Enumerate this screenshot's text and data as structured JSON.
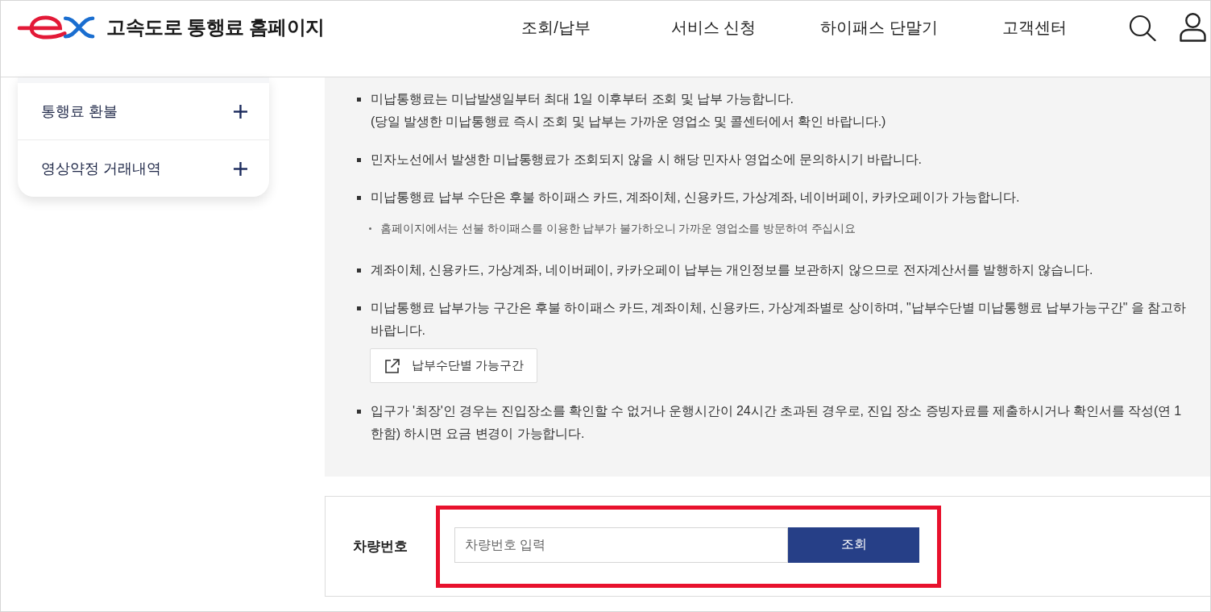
{
  "header": {
    "title": "고속도로 통행료 홈페이지",
    "nav": [
      {
        "label": "조회/납부"
      },
      {
        "label": "서비스 신청"
      },
      {
        "label": "하이패스 단말기"
      },
      {
        "label": "고객센터"
      }
    ]
  },
  "sidebar": {
    "items": [
      {
        "label": "통행료 환불",
        "expanded": false
      },
      {
        "label": "영상약정 거래내역",
        "expanded": false
      }
    ]
  },
  "notices": [
    {
      "lines": [
        "미납통행료는 미납발생일부터 최대 1일 이후부터 조회 및 납부 가능합니다.",
        "(당일 발생한 미납통행료 즉시 조회 및 납부는 가까운 영업소 및 콜센터에서 확인 바랍니다.)"
      ]
    },
    {
      "lines": [
        "민자노선에서 발생한 미납통행료가 조회되지 않을 시 해당 민자사 영업소에 문의하시기 바랍니다."
      ]
    },
    {
      "lines": [
        "미납통행료 납부 수단은 후불 하이패스 카드, 계좌이체, 신용카드, 가상계좌, 네이버페이, 카카오페이가 가능합니다."
      ],
      "note": "홈페이지에서는 선불 하이패스를 이용한 납부가 불가하오니 가까운 영업소를 방문하여 주십시요"
    },
    {
      "lines": [
        "계좌이체, 신용카드, 가상계좌, 네이버페이, 카카오페이 납부는 개인정보를 보관하지 않으므로 전자계산서를 발행하지 않습니다."
      ]
    },
    {
      "lines": [
        "미납통행료 납부가능 구간은 후불 하이패스 카드, 계좌이체, 신용카드, 가상계좌별로 상이하며, \"납부수단별 미납통행료 납부가능구간\" 을 참고하",
        "바랍니다."
      ],
      "link_button": "납부수단별 가능구간"
    },
    {
      "lines": [
        "입구가 '최장'인 경우는 진입장소를 확인할 수 없거나 운행시간이 24시간 초과된 경우로, 진입 장소 증빙자료를 제출하시거나 확인서를 작성(연 1",
        "한함) 하시면 요금 변경이 가능합니다."
      ]
    }
  ],
  "search": {
    "label": "차량번호",
    "placeholder": "차량번호 입력",
    "button": "조회",
    "highlighted": true
  }
}
